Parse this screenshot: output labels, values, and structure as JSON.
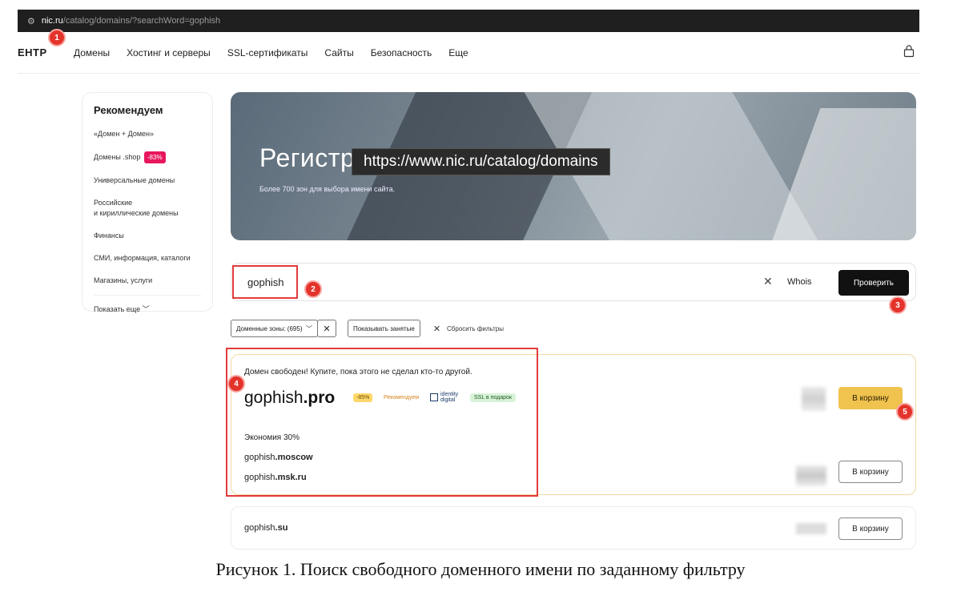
{
  "browser": {
    "url_host": "nic.ru",
    "url_path": "/catalog/domains/?searchWord=gophish"
  },
  "nav": {
    "logo": "ЕНТР",
    "items": [
      "Домены",
      "Хостинг и серверы",
      "SSL-сертификаты",
      "Сайты",
      "Безопасность",
      "Еще"
    ]
  },
  "sidebar": {
    "title": "Рекомендуем",
    "items": [
      {
        "label": "«Домен + Домен»"
      },
      {
        "label": "Домены .shop",
        "badge": "-83%"
      },
      {
        "label": "Универсальные домены"
      },
      {
        "label": "Российские",
        "label2": "и кириллические домены"
      },
      {
        "label": "Финансы"
      },
      {
        "label": "СМИ, информация, каталоги"
      },
      {
        "label": "Магазины, услуги"
      }
    ],
    "show_more": "Показать еще"
  },
  "hero": {
    "title": "Регистр",
    "subtitle": "Более 700 зон для выбора имени сайта.",
    "tooltip": "https://www.nic.ru/catalog/domains"
  },
  "search": {
    "value": "gophish",
    "clear": "✕",
    "whois": "Whois",
    "submit": "Проверить"
  },
  "filters": {
    "zones": "Доменные зоны: (695)",
    "show_taken": "Показывать занятые",
    "reset": "Сбросить фильтры"
  },
  "result": {
    "message": "Домен свободен! Купите, пока этого не сделал кто-то другой.",
    "domain_name": "gophish",
    "domain_tld": ".pro",
    "discount": "-85%",
    "recommend": "Рекомендуем",
    "registry_line1": "identity",
    "registry_line2": "digital",
    "ssl_tag": "SSL в подарок",
    "cart_label": "В корзину",
    "savings": "Экономия 30%",
    "alternatives": [
      {
        "name": "gophish",
        "tld": ".moscow"
      },
      {
        "name": "gophish",
        "tld": ".msk.ru"
      }
    ],
    "alt_cart_label": "В корзину"
  },
  "result2": {
    "name": "gophish",
    "tld": ".su",
    "cart_label": "В корзину"
  },
  "markers": [
    "1",
    "2",
    "3",
    "4",
    "5"
  ],
  "caption": "Рисунок 1. Поиск свободного доменного имени по заданному фильтру",
  "colors": {
    "accent_red": "#e4332b",
    "cart_yellow": "#f0c24e",
    "badge_pink": "#e8175d"
  }
}
